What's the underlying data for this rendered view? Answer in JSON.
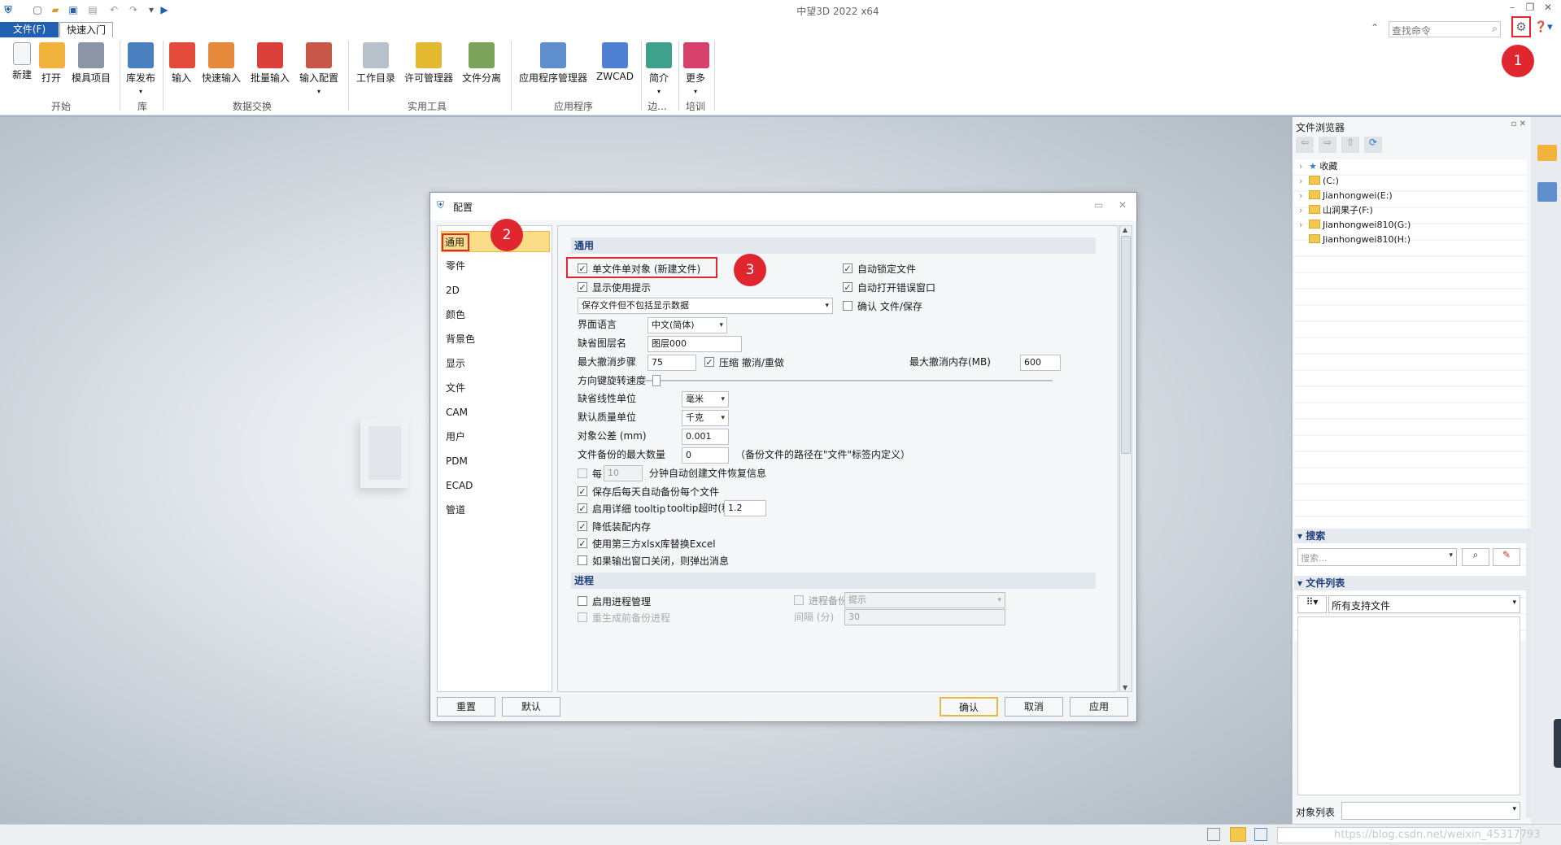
{
  "app": {
    "title": "中望3D 2022 x64"
  },
  "menubar": {
    "file_tab": "文件(F)",
    "quick_tab": "快速入门",
    "search_placeholder": "查找命令"
  },
  "ribbon": {
    "groups": [
      {
        "label": "开始"
      },
      {
        "label": "库"
      },
      {
        "label": "数据交换"
      },
      {
        "label": "实用工具"
      },
      {
        "label": "应用程序"
      },
      {
        "label": "边..."
      },
      {
        "label": "培训"
      }
    ],
    "buttons": [
      {
        "label": "新建"
      },
      {
        "label": "打开"
      },
      {
        "label": "模具项目"
      },
      {
        "label": "库发布"
      },
      {
        "label": "输入"
      },
      {
        "label": "快速输入"
      },
      {
        "label": "批量输入"
      },
      {
        "label": "输入配置"
      },
      {
        "label": "工作目录"
      },
      {
        "label": "许可管理器"
      },
      {
        "label": "文件分离"
      },
      {
        "label": "应用程序管理器"
      },
      {
        "label": "ZWCAD"
      },
      {
        "label": "简介"
      },
      {
        "label": "更多"
      }
    ]
  },
  "badges": [
    "1",
    "2",
    "3"
  ],
  "dialog": {
    "title": "配置",
    "nav": [
      "通用",
      "零件",
      "2D",
      "颜色",
      "背景色",
      "显示",
      "文件",
      "CAM",
      "用户",
      "PDM",
      "ECAD",
      "管道"
    ],
    "section_general": "通用",
    "section_process": "进程",
    "options": {
      "single_file": "单文件单对象 (新建文件)",
      "show_tips": "显示使用提示",
      "auto_lock": "自动锁定文件",
      "auto_open_err": "自动打开错误窗口",
      "confirm_save": "确认 文件/保存",
      "save_mode": "保存文件但不包括显示数据",
      "ui_lang_label": "界面语言",
      "ui_lang_value": "中文(简体)",
      "layer_label": "缺省图层名",
      "layer_value": "图层000",
      "max_undo_label": "最大撤消步骤",
      "max_undo_value": "75",
      "compress_undo": "压缩 撤消/重做",
      "max_undo_mem_label": "最大撤消内存(MB)",
      "max_undo_mem_value": "600",
      "rotate_speed_label": "方向键旋转速度",
      "linear_unit_label": "缺省线性单位",
      "linear_unit_value": "毫米",
      "mass_unit_label": "默认质量单位",
      "mass_unit_value": "千克",
      "tolerance_label": "对象公差 (mm)",
      "tolerance_value": "0.001",
      "backup_label": "文件备份的最大数量",
      "backup_value": "0",
      "backup_note": "（备份文件的路径在\"文件\"标签内定义）",
      "every_label": "每",
      "every_value": "10",
      "every_suffix": "分钟自动创建文件恢复信息",
      "daily_backup": "保存后每天自动备份每个文件",
      "detail_tooltip": "启用详细 tooltip",
      "tooltip_timeout_label": "tooltip超时(秒)",
      "tooltip_timeout_value": "1.2",
      "reduce_mem": "降低装配内存",
      "third_party_xlsx": "使用第三方xlsx库替换Excel",
      "popup_on_close": "如果输出窗口关闭，则弹出消息",
      "enable_process": "启用进程管理",
      "process_backup": "进程备份",
      "process_backup_value": "提示",
      "gen_backup_partial": "重生成前备份进程",
      "interval_partial": "间隔 (分)",
      "interval_value": "30"
    },
    "buttons": {
      "reset": "重置",
      "default": "默认",
      "ok": "确认",
      "cancel": "取消",
      "apply": "应用"
    }
  },
  "file_browser": {
    "title": "文件浏览器",
    "tree": [
      {
        "label": "收藏"
      },
      {
        "label": "(C:)"
      },
      {
        "label": "Jianhongwei(E:)"
      },
      {
        "label": "山涧果子(F:)"
      },
      {
        "label": "Jianhongwei810(G:)"
      },
      {
        "label": "Jianhongwei810(H:)"
      }
    ],
    "search_header": "搜索",
    "search_placeholder": "搜索...",
    "filelist_header": "文件列表",
    "filelist_filter": "所有支持文件",
    "object_list_label": "对象列表"
  },
  "status": {
    "watermark": "https://blog.csdn.net/weixin_45317793"
  }
}
